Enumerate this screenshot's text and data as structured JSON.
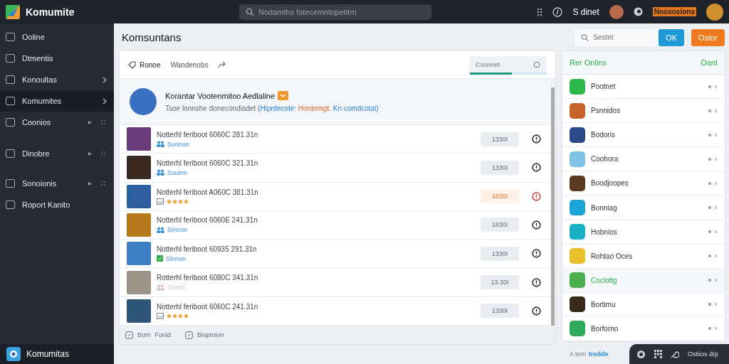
{
  "topbar": {
    "brand": "Komumite",
    "search": {
      "placeholder": "Nodamths fatecemntopetitm"
    },
    "user_label": "S dinet",
    "alert_label": "Noososions"
  },
  "sidebar": {
    "items": [
      {
        "label": "Ooline",
        "selected": false,
        "kind": "plain"
      },
      {
        "label": "Dtmentis",
        "selected": false,
        "kind": "plain"
      },
      {
        "label": "Konoultas",
        "selected": false,
        "kind": "submenu"
      },
      {
        "label": "Komumites",
        "selected": true,
        "kind": "submenu"
      },
      {
        "label": "Coonios",
        "selected": false,
        "kind": "expandable"
      },
      {
        "label": "Dinobre",
        "selected": false,
        "kind": "expandable"
      },
      {
        "label": "Sonoionis",
        "selected": false,
        "kind": "expandable"
      },
      {
        "label": "Roport Kanito",
        "selected": false,
        "kind": "plain"
      }
    ],
    "footer": "Komumitas"
  },
  "page": {
    "title": "Komsuntans",
    "search": {
      "placeholder": "Sestet"
    },
    "buttons": [
      {
        "label": "OK",
        "kind": "primary"
      },
      {
        "label": "Ostor",
        "kind": "accent"
      }
    ]
  },
  "list_card": {
    "toolbar": {
      "tabs": [
        {
          "label": "Ronoe",
          "selected": true
        },
        {
          "label": "Wandenobs",
          "selected": false
        }
      ],
      "search": {
        "placeholder": "Coonnet",
        "level": 0.55
      }
    },
    "featured": {
      "title": "Korantar Vootenmitoo Aedlaline",
      "description": [
        {
          "text": "Tsoe lonnshe donecondiadet (",
          "kind": "plain"
        },
        {
          "text": "Hipntecote:",
          "kind": "link"
        },
        {
          "text": " Hontemgt.",
          "kind": "highlight"
        },
        {
          "text": " Kn comdcotal)",
          "kind": "link"
        }
      ]
    },
    "rows": [
      {
        "title": "Notterhl feriboot 6060C 281.31n",
        "kind": "players",
        "meta": "Sonnon",
        "badge": "1330I",
        "alert": false
      },
      {
        "title": "Notterhl feriboot 6060C 321.31n",
        "kind": "players",
        "meta": "Suuinn",
        "badge": "1330I",
        "alert": false
      },
      {
        "title": "Notterhl feriboot A060C 381.31n",
        "kind": "stars",
        "stars": 4,
        "badge": "1830I",
        "alert": true
      },
      {
        "title": "Notterhl feriboot 6060E 241.31n",
        "kind": "players",
        "meta": "Sinnon",
        "badge": "1830I",
        "alert": false
      },
      {
        "title": "Notterhl feriboot 60935 291.31n",
        "kind": "check",
        "meta": "Slnnon",
        "badge": "1330I",
        "alert": false
      },
      {
        "title": "Rotterhl feriboot 6080C 341.31n",
        "kind": "faded",
        "meta": "Sinnsl",
        "badge": "13.30I",
        "alert": false
      },
      {
        "title": "Notterhl feriboot 6060C 241.31n",
        "kind": "stars",
        "stars": 4,
        "badge": "1330I",
        "alert": false
      }
    ],
    "footer": [
      {
        "label": "Bom"
      },
      {
        "label": "Fonid"
      },
      {
        "label": "Biopmion"
      }
    ]
  },
  "online_panel": {
    "title": "Rer Onlins",
    "action": "Oant",
    "items": [
      {
        "name": "Pootnet",
        "selected": false
      },
      {
        "name": "Psnnidos",
        "selected": false
      },
      {
        "name": "Bodoris",
        "selected": false
      },
      {
        "name": "Coohora",
        "selected": false
      },
      {
        "name": "Boodjoopes",
        "selected": false
      },
      {
        "name": "Bonniag",
        "selected": false
      },
      {
        "name": "Hobnios",
        "selected": false
      },
      {
        "name": "Rohtao Oces",
        "selected": false
      },
      {
        "name": "Coclottg",
        "selected": true
      },
      {
        "name": "Bortimu",
        "selected": false
      },
      {
        "name": "Borforno",
        "selected": false
      }
    ]
  },
  "status_bar": {
    "left": "A tem",
    "link": "Irodde",
    "dock_label": "Ostiios drp"
  }
}
